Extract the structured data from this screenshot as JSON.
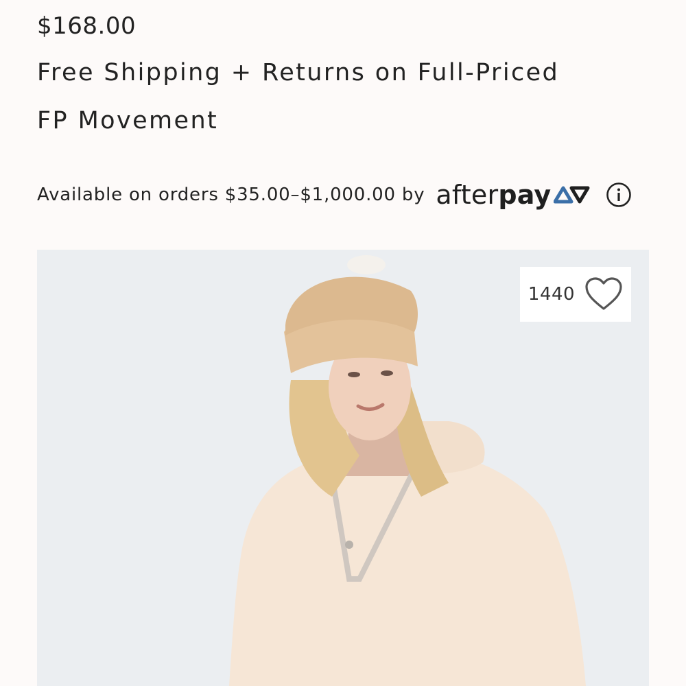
{
  "product": {
    "price": "$168.00",
    "shipping_note": "Free Shipping + Returns on Full-Priced",
    "brand": "FP Movement"
  },
  "afterpay": {
    "message": "Available on orders $35.00–$1,000.00 by",
    "logo_light": "after",
    "logo_bold": "pay",
    "logo_icon": "afterpay-arrows-icon",
    "info_icon": "info-circle-icon"
  },
  "image": {
    "description_icon": "product-photo",
    "like_count": "1440",
    "like_icon": "heart-outline-icon"
  },
  "colors": {
    "background": "#fdfaf9",
    "text": "#222222",
    "afterpay_blue": "#3b6fa8"
  }
}
